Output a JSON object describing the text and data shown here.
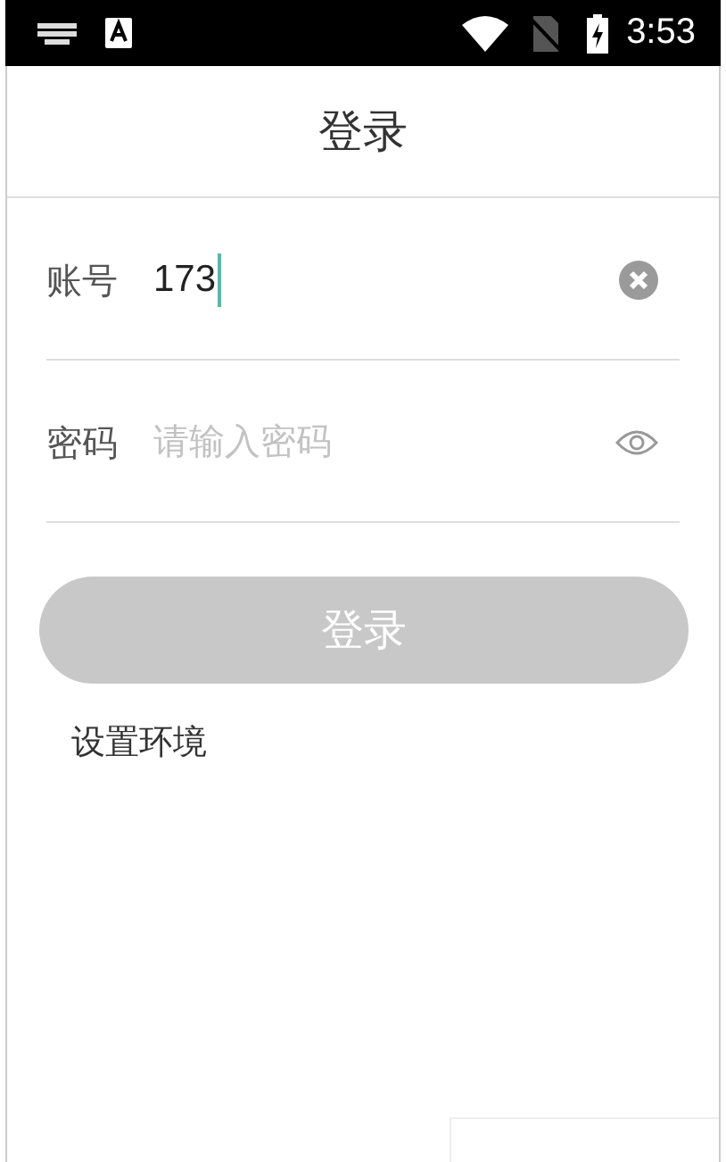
{
  "status_bar": {
    "time": "3:53"
  },
  "title": "登录",
  "fields": [
    {
      "kind": "account",
      "label": "账号",
      "value": "173",
      "focused": true
    },
    {
      "kind": "password",
      "label": "密码",
      "placeholder": "请输入密码",
      "focused": false
    }
  ],
  "login_button": {
    "label": "登录",
    "disabled": true
  },
  "environment_link": "设置环境"
}
